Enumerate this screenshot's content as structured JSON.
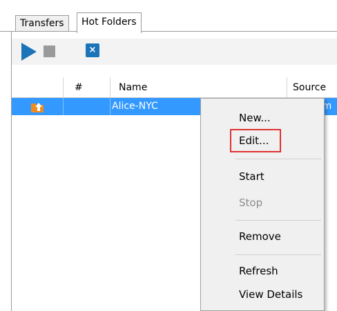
{
  "tabs": [
    {
      "label": "Transfers",
      "active": false
    },
    {
      "label": "Hot Folders",
      "active": true
    }
  ],
  "toolbar": {
    "icons": [
      "play-icon",
      "stop-icon",
      "close-icon"
    ],
    "close_glyph": "×"
  },
  "table": {
    "columns": [
      "",
      "#",
      "Name",
      "Source"
    ],
    "rows": [
      {
        "icon": "upload-folder-icon",
        "number": "",
        "name": "Alice-NYC",
        "source": "om",
        "selected": true
      }
    ]
  },
  "context_menu": {
    "items": [
      {
        "label": "New...",
        "enabled": true
      },
      {
        "label": "Edit...",
        "enabled": true,
        "highlighted": true
      },
      {
        "label": "Start",
        "enabled": true
      },
      {
        "label": "Stop",
        "enabled": false
      },
      {
        "label": "Remove",
        "enabled": true
      },
      {
        "label": "Refresh",
        "enabled": true
      },
      {
        "label": "View Details",
        "enabled": true
      }
    ]
  },
  "colors": {
    "selection": "#3399ff",
    "highlight_box": "#e03030",
    "play": "#1b73b8",
    "stop": "#9a9a9a"
  }
}
